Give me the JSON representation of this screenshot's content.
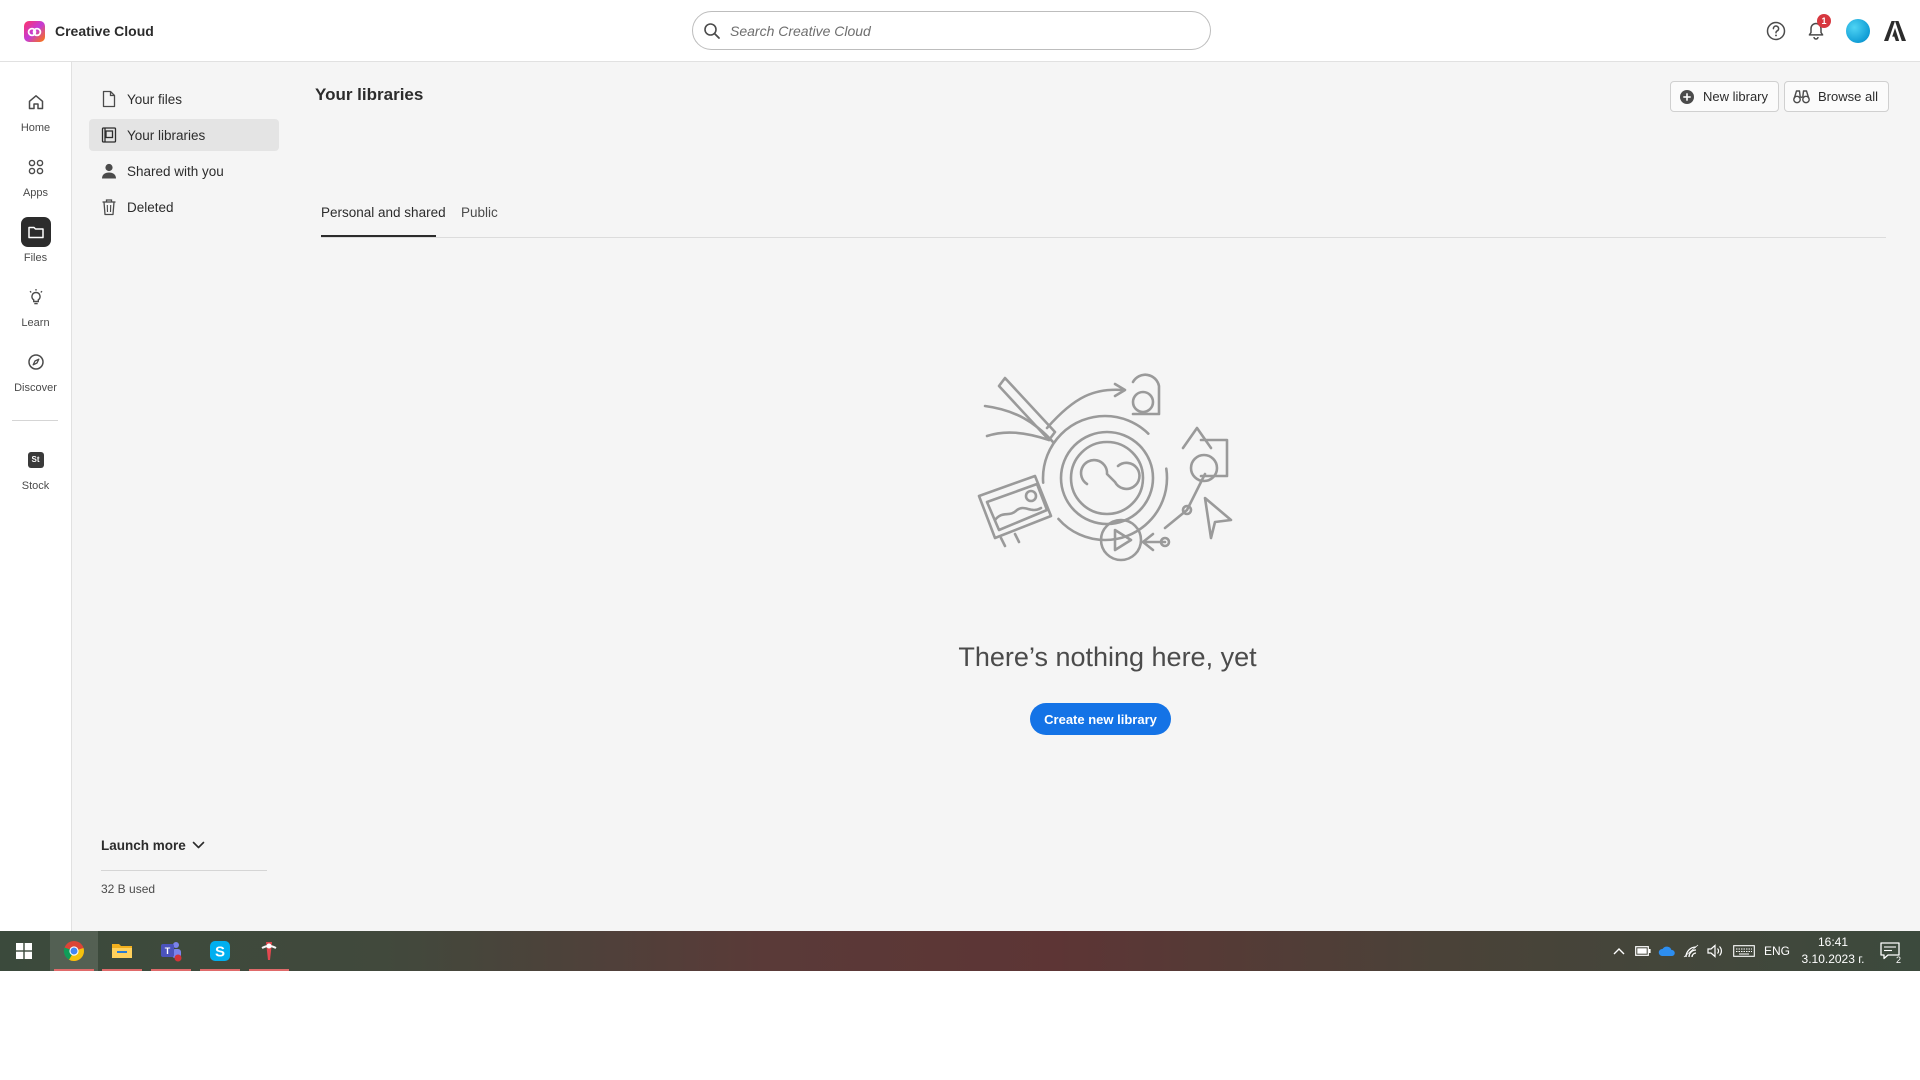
{
  "header": {
    "app_name": "Creative Cloud",
    "search_placeholder": "Search Creative Cloud",
    "notification_count": "1"
  },
  "rail": {
    "items": [
      {
        "label": "Home",
        "icon": "home-icon"
      },
      {
        "label": "Apps",
        "icon": "apps-grid-icon"
      },
      {
        "label": "Files",
        "icon": "folder-icon",
        "active": true
      },
      {
        "label": "Learn",
        "icon": "lightbulb-icon"
      },
      {
        "label": "Discover",
        "icon": "compass-icon"
      },
      {
        "label": "Stock",
        "icon": "stock-icon",
        "icon_text": "St"
      }
    ]
  },
  "sidenav": {
    "items": [
      {
        "label": "Your files",
        "icon": "file-icon"
      },
      {
        "label": "Your libraries",
        "icon": "library-icon",
        "active": true
      },
      {
        "label": "Shared with you",
        "icon": "user-icon"
      },
      {
        "label": "Deleted",
        "icon": "trash-icon"
      }
    ],
    "launch_more": "Launch more",
    "storage": "32 B used"
  },
  "main": {
    "title": "Your libraries",
    "new_library": "New library",
    "browse_all": "Browse all",
    "tabs": [
      {
        "label": "Personal and shared",
        "active": true
      },
      {
        "label": "Public"
      }
    ],
    "empty_title": "There’s nothing here, yet",
    "create_button": "Create new library"
  },
  "taskbar": {
    "apps": [
      "start-icon",
      "chrome-icon",
      "file-explorer-icon",
      "teams-icon",
      "skype-icon",
      "creative-cloud-app-icon"
    ],
    "language": "ENG",
    "time": "16:41",
    "date": "3.10.2023 г.",
    "notification_count": "2"
  },
  "colors": {
    "accent": "#1473e6",
    "badge": "#d7373f",
    "sidebar_bg": "#f5f5f5"
  }
}
